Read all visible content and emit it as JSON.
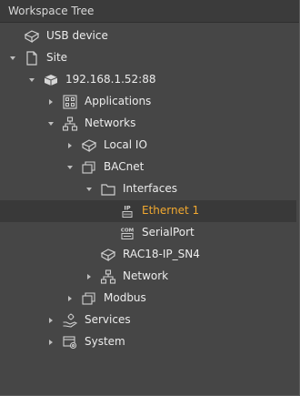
{
  "panel": {
    "title": "Workspace Tree"
  },
  "tree": {
    "usb_device": "USB device",
    "site": "Site",
    "ip": "192.168.1.52:88",
    "applications": "Applications",
    "networks": "Networks",
    "local_io": "Local IO",
    "bacnet": "BACnet",
    "interfaces": "Interfaces",
    "ethernet1": "Ethernet 1",
    "serialport": "SerialPort",
    "rac": "RAC18-IP_SN4",
    "network": "Network",
    "modbus": "Modbus",
    "services": "Services",
    "system": "System",
    "icon_text": {
      "ip": "IP",
      "com": "COM"
    },
    "selected_item": "Ethernet 1"
  },
  "colors": {
    "background": "#464646",
    "header": "#3b3b3b",
    "selected_row": "#393939",
    "selected_text": "#f0a830",
    "text": "#ececec",
    "icon": "#cfcfcf"
  },
  "icons": {
    "usb_device": "usb-device-icon",
    "site": "document-icon",
    "ip": "controller-icon",
    "applications": "grid-icon",
    "networks": "network-tree-icon",
    "local_io": "cube-icon",
    "bacnet": "stacked-windows-icon",
    "interfaces": "folder-icon",
    "ethernet1": "ip-port-icon",
    "serialport": "com-port-icon",
    "rac": "cube-icon",
    "network": "network-tree-icon",
    "modbus": "stacked-windows-icon",
    "services": "hand-gear-icon",
    "system": "system-settings-icon"
  }
}
